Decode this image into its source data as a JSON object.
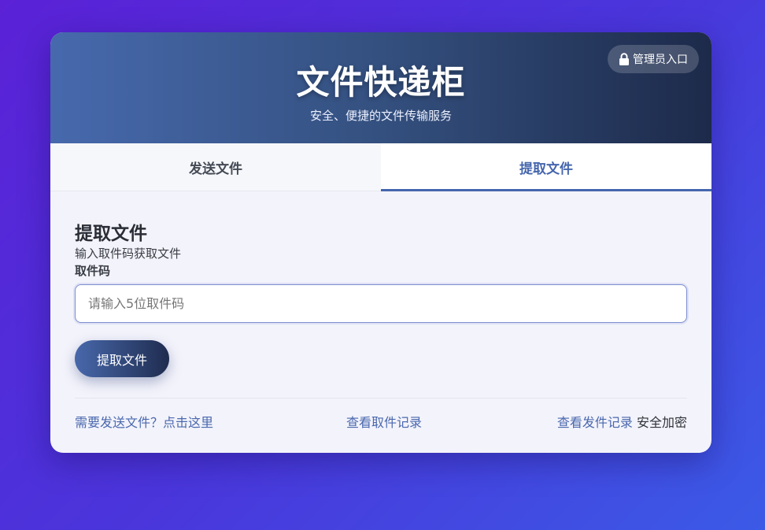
{
  "header": {
    "title": "文件快递柜",
    "subtitle": "安全、便捷的文件传输服务",
    "admin_button": "管理员入口"
  },
  "tabs": [
    {
      "label": "发送文件",
      "active": false
    },
    {
      "label": "提取文件",
      "active": true
    }
  ],
  "main": {
    "section_title": "提取文件",
    "section_desc": "输入取件码获取文件",
    "code_label": "取件码",
    "code_placeholder": "请输入5位取件码",
    "code_value": "",
    "submit_label": "提取文件"
  },
  "footer": {
    "send_link": "需要发送文件？点击这里",
    "pickup_history_link": "查看取件记录",
    "send_history_link": "查看发件记录",
    "secure_text": "安全加密"
  },
  "colors": {
    "accent": "#4566ad",
    "background_start": "#5b21d6",
    "background_end": "#3b5ae6"
  },
  "icons": {
    "admin": "lock-icon"
  }
}
